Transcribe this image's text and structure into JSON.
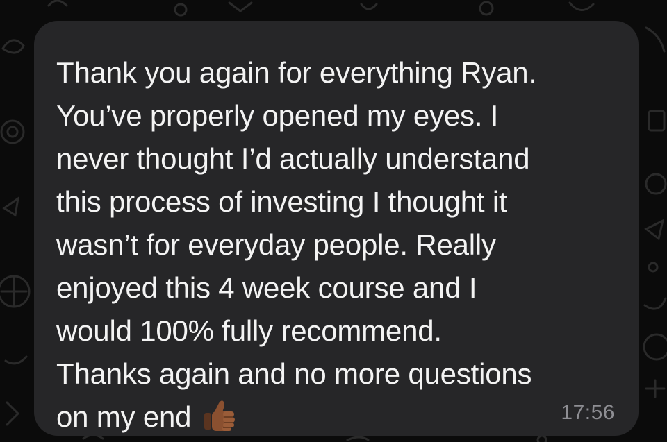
{
  "message": {
    "lines": [
      "Thank you again for everything Ryan.",
      "You’ve properly opened my eyes. I",
      "never thought I’d actually understand",
      "this process of investing I thought it",
      "wasn’t for everyday people. Really",
      "enjoyed this 4 week course and I",
      "would 100% fully recommend.",
      "Thanks again and no more questions",
      "on my end"
    ],
    "emoji": "thumbs-up-medium-dark-skin",
    "time": "17:56"
  },
  "colors": {
    "background": "#0b0b0b",
    "bubble": "#262628",
    "text": "#f3f3f3",
    "timestamp": "#8e8e93",
    "emoji_skin": "#8a5030"
  }
}
